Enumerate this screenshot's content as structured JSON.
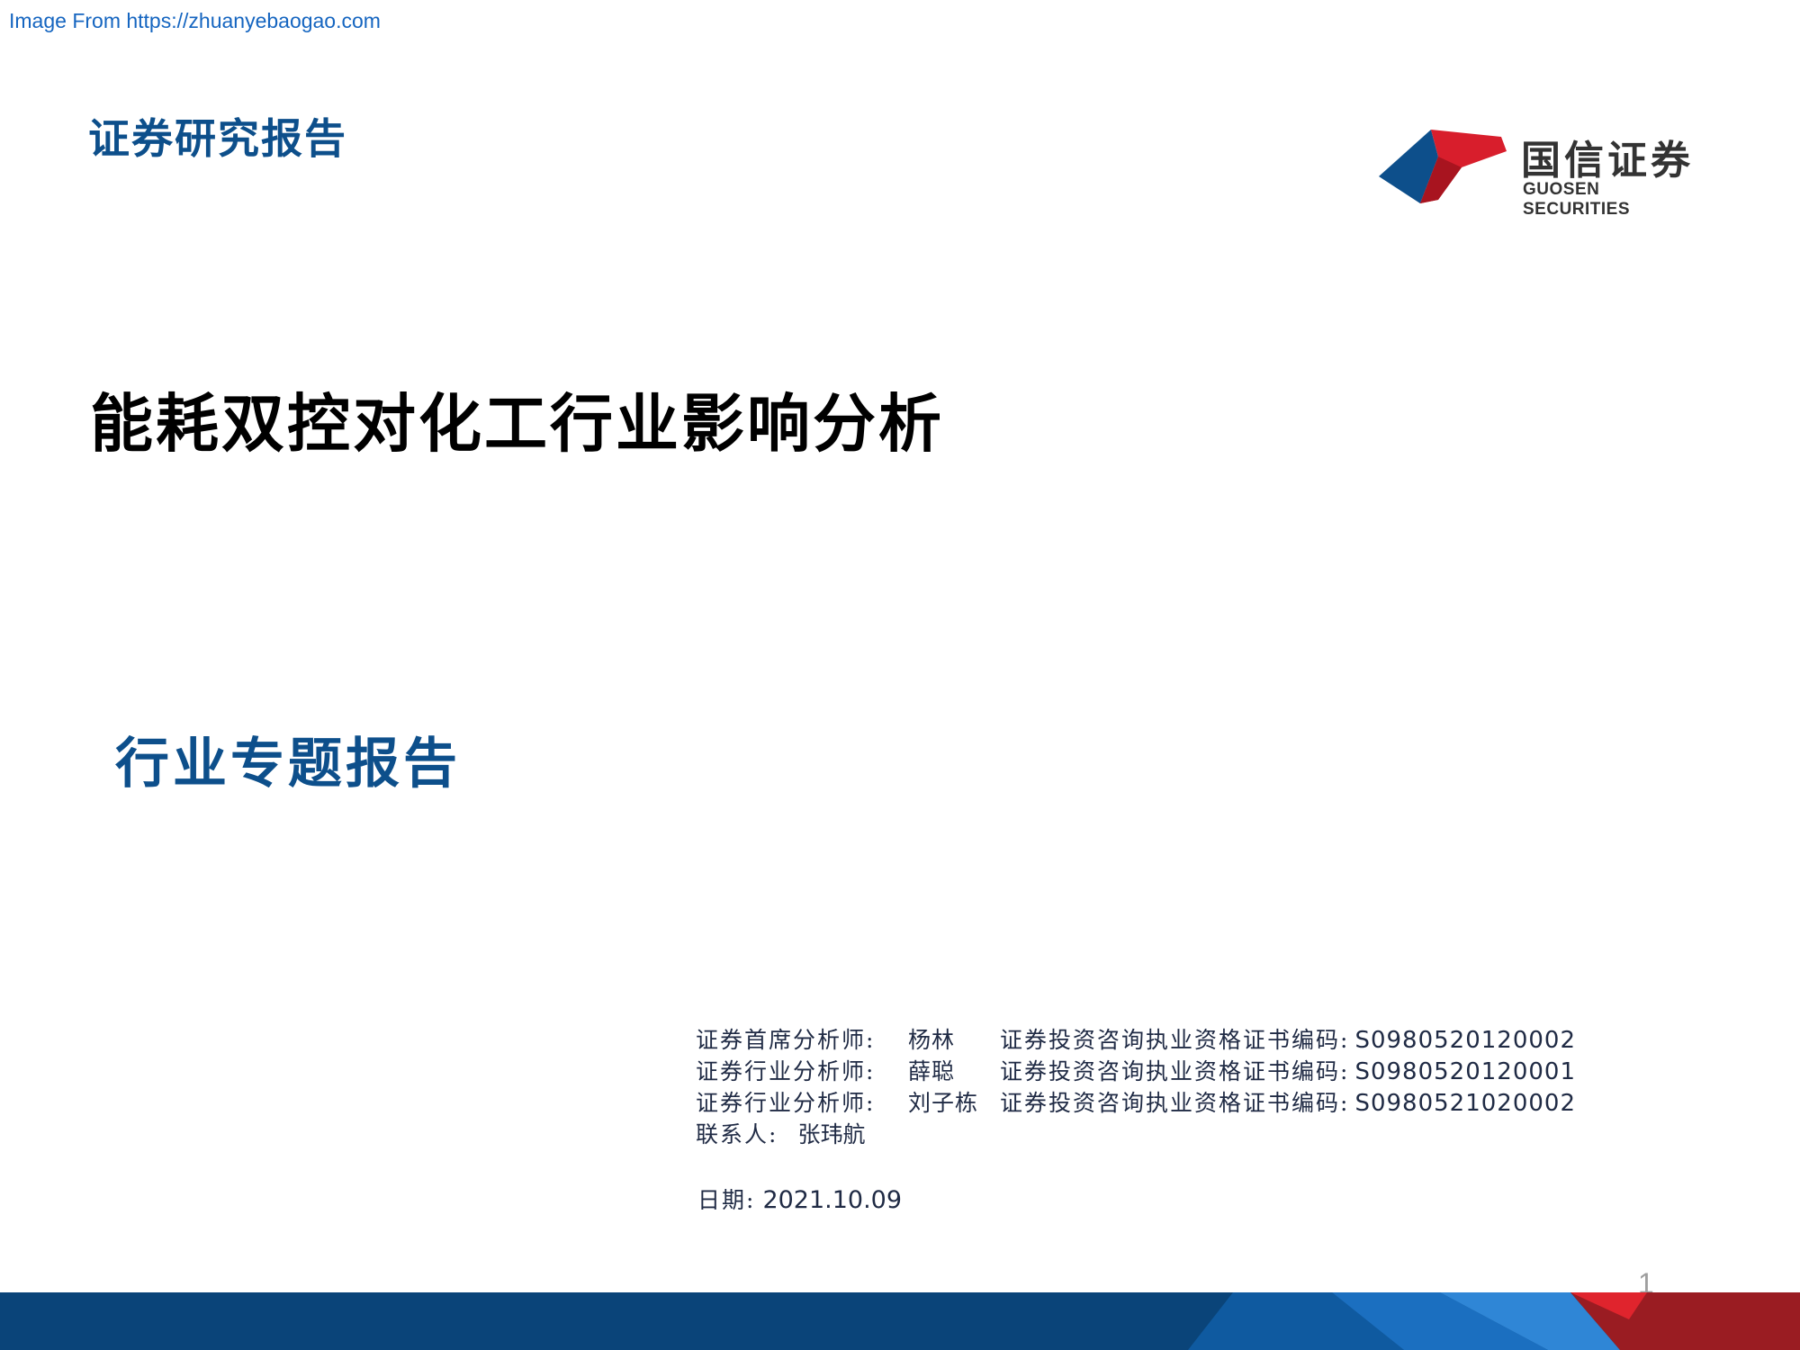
{
  "watermark": "Image From https://zhuanyebaogao.com",
  "section_label": "证券研究报告",
  "logo": {
    "name_cn": "国信证券",
    "name_en": "GUOSEN SECURITIES",
    "icon": "guosen-logo-icon",
    "colors": {
      "red": "#d81e2c",
      "blue": "#0d4f8b"
    }
  },
  "title": "能耗双控对化工行业影响分析",
  "subtitle": "行业专题报告",
  "analysts": [
    {
      "role": "证券首席分析师:",
      "name": "杨林",
      "cert_label": "证券投资咨询执业资格证书编码:",
      "cert_code": "S0980520120002"
    },
    {
      "role": "证券行业分析师:",
      "name": "薛聪",
      "cert_label": "证券投资咨询执业资格证书编码:",
      "cert_code": "S0980520120001"
    },
    {
      "role": "证券行业分析师:",
      "name": "刘子栋",
      "cert_label": "证券投资咨询执业资格证书编码:",
      "cert_code": "S0980521020002"
    }
  ],
  "contact": {
    "label": "联系人:",
    "name": "张玮航"
  },
  "date": {
    "label": "日期:",
    "value": "2021.10.09"
  },
  "page_number": "1",
  "colors": {
    "brand_blue": "#0d4f8b",
    "footer_blue": "#0a4479",
    "footer_red": "#9a1c22"
  }
}
